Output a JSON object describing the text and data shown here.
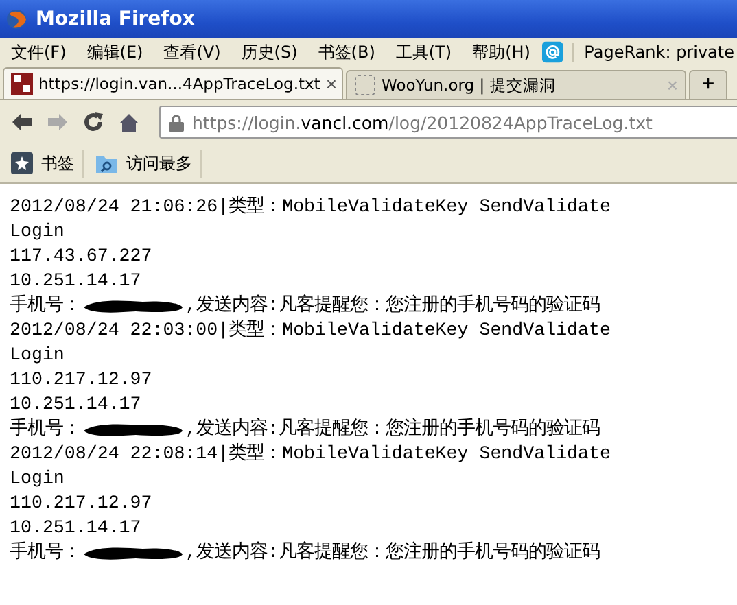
{
  "window": {
    "title": "Mozilla Firefox"
  },
  "menu": [
    "文件(F)",
    "编辑(E)",
    "查看(V)",
    "历史(S)",
    "书签(B)",
    "工具(T)",
    "帮助(H)"
  ],
  "pagerank": "PageRank: private",
  "tabs": [
    {
      "label": "https://login.van...4AppTraceLog.txt",
      "close": "×",
      "selected": true
    },
    {
      "label": "WooYun.org | 提交漏洞",
      "close": "×",
      "selected": false
    }
  ],
  "new_tab": "+",
  "nav": {
    "back_disabled": false,
    "forward_disabled": true,
    "url": {
      "prefix": "https://login.",
      "domain": "vancl.com",
      "path": "/log/20120824AppTraceLog.txt"
    }
  },
  "bookmarks": [
    "书签",
    "访问最多"
  ],
  "log": [
    {
      "header": "2012/08/24 21:06:26|类型：MobileValidateKey SendValidate",
      "lines": [
        "Login",
        "117.43.67.227",
        "10.251.14.17"
      ],
      "phone_label": "手机号：",
      "message": ",发送内容:凡客提醒您：您注册的手机号码的验证码"
    },
    {
      "header": "2012/08/24 22:03:00|类型：MobileValidateKey SendValidate",
      "lines": [
        "Login",
        "110.217.12.97",
        "10.251.14.17"
      ],
      "phone_label": "手机号：",
      "message": ",发送内容:凡客提醒您：您注册的手机号码的验证码"
    },
    {
      "header": "2012/08/24 22:08:14|类型：MobileValidateKey SendValidate",
      "lines": [
        "Login",
        "110.217.12.97",
        "10.251.14.17"
      ],
      "phone_label": "手机号：",
      "message": ",发送内容:凡客提醒您：您注册的手机号码的验证码"
    }
  ]
}
